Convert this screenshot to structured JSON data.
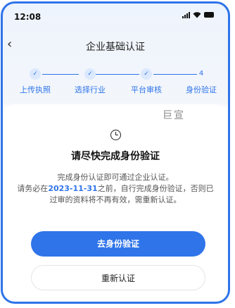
{
  "status_bar": {
    "time": "12:08"
  },
  "nav": {
    "back_icon": "chevron-left-icon",
    "title": "企业基础认证"
  },
  "steps": [
    {
      "label": "上传执照",
      "marker": "✓",
      "state": "done"
    },
    {
      "label": "选择行业",
      "marker": "✓",
      "state": "done"
    },
    {
      "label": "平台审核",
      "marker": "✓",
      "state": "done"
    },
    {
      "label": "身份验证",
      "marker": "4",
      "state": "current"
    }
  ],
  "watermark": "巨宣",
  "content": {
    "icon": "clock-icon",
    "headline": "请尽快完成身份验证",
    "desc_line1": "完成身份认证即可通过企业认证。",
    "desc_line2_pre": "请务必在",
    "desc_date": "2023-11-31",
    "desc_line2_post": "之前，自行完成身份验证，否则已",
    "desc_line3": "过审的资料将不再有效，需重新认证。"
  },
  "buttons": {
    "primary": "去身份验证",
    "secondary": "重新认证"
  },
  "colors": {
    "accent": "#2f74e9",
    "text": "#222222",
    "muted": "#555555"
  }
}
